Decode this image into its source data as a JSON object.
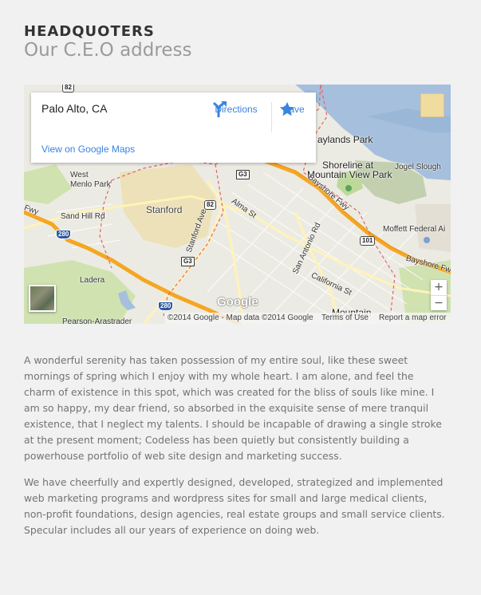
{
  "header": {
    "title": "HEADQUOTERS",
    "subtitle": "Our C.E.O address"
  },
  "map": {
    "place_card": {
      "name": "Palo Alto, CA",
      "directions_label": "Directions",
      "save_label": "Save",
      "view_link": "View on Google Maps"
    },
    "logo": "Google",
    "attribution": {
      "copyright": "©2014 Google - Map data ©2014 Google",
      "terms": "Terms of Use",
      "report": "Report a map error"
    },
    "zoom": {
      "in": "+",
      "out": "−"
    },
    "labels": {
      "west_menlo_park": [
        "West",
        "Menlo Park"
      ],
      "stanford": "Stanford",
      "sand_hill_rd": "Sand Hill Rd",
      "ladera": "Ladera",
      "pearson_arastradero": "Pearson-Arastrader",
      "alma_st": "Alma St",
      "stanford_ave": "Stanford Ave",
      "shoreline": [
        "Shoreline at",
        "Mountain View Park"
      ],
      "baylands_park": "aylands Park",
      "jogel_slough": "Jogel Slough",
      "moffett": "Moffett Federal Ai",
      "bayshore_fwy": "Bayshore Fwy",
      "bayshore_fwy_2": "Bayshore Fw",
      "san_antonio_rd": "San Antonio Rd",
      "california_st": "California St",
      "mountain": "Mountain",
      "fwy": "Fwy"
    },
    "shields": {
      "us101": "101",
      "i280_a": "280",
      "i280_b": "280",
      "ca82_a": "82",
      "ca82_b": "82",
      "g3_a": "G3",
      "g3_b": "G3"
    },
    "colors": {
      "land": "#ecebe3",
      "water": "#a5bfdd",
      "freeway": "#f5a623",
      "park": "#c8dfa8",
      "campus": "#ece1b8",
      "link": "#3a84df"
    }
  },
  "content": {
    "paragraph_1": "A wonderful serenity has taken possession of my entire soul, like these sweet mornings of spring which I enjoy with my whole heart. I am alone, and feel the charm of existence in this spot, which was created for the bliss of souls like mine. I am so happy, my dear friend, so absorbed in the exquisite sense of mere tranquil existence, that I neglect my talents. I should be incapable of drawing a single stroke at the present moment; Codeless has been quietly but consistently building a powerhouse portfolio of web site design and marketing success.",
    "paragraph_2": "We have cheerfully and expertly designed, developed, strategized and implemented web marketing programs and wordpress sites for small and large medical clients, non-profit foundations, design agencies, real estate groups and small service clients. Specular includes all our years of experience on doing web."
  }
}
